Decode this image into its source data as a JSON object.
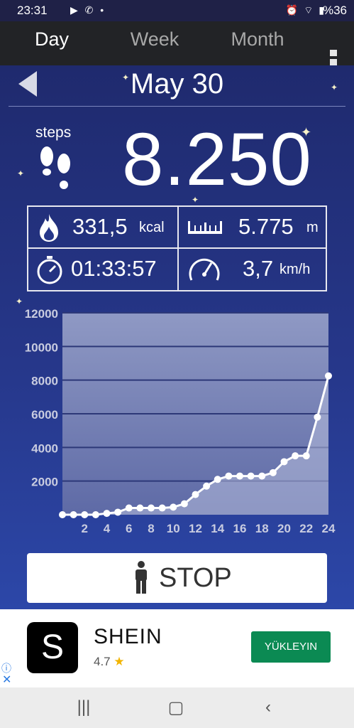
{
  "status_bar": {
    "time": "23:31",
    "app_icons": "▶ ✆ •",
    "system_icons": "⏰ ⌔ ▮",
    "battery": "%36"
  },
  "tabs": [
    {
      "label": "Day",
      "active": true
    },
    {
      "label": "Week",
      "active": false
    },
    {
      "label": "Month",
      "active": false
    }
  ],
  "header": {
    "date": "May 30"
  },
  "steps": {
    "label": "steps",
    "value": "8.250"
  },
  "stats": {
    "calories": {
      "value": "331,5",
      "unit": "kcal"
    },
    "distance": {
      "value": "5.775",
      "unit": "m"
    },
    "duration": {
      "value": "01:33:57"
    },
    "speed": {
      "value": "3,7",
      "unit": "km/h"
    }
  },
  "chart_data": {
    "type": "line",
    "x": [
      0,
      1,
      2,
      3,
      4,
      5,
      6,
      7,
      8,
      9,
      10,
      11,
      12,
      13,
      14,
      15,
      16,
      17,
      18,
      19,
      20,
      21,
      22,
      23,
      24
    ],
    "values": [
      0,
      0,
      0,
      0,
      80,
      150,
      400,
      400,
      400,
      400,
      450,
      650,
      1200,
      1700,
      2100,
      2300,
      2300,
      2300,
      2300,
      2500,
      3150,
      3500,
      3500,
      5800,
      8250
    ],
    "xticks": [
      "2",
      "4",
      "6",
      "8",
      "10",
      "12",
      "14",
      "16",
      "18",
      "20",
      "22",
      "24"
    ],
    "yticks": [
      "2000",
      "4000",
      "6000",
      "8000",
      "10000",
      "12000"
    ],
    "xlim": [
      0,
      24
    ],
    "ylim": [
      0,
      12000
    ],
    "grid": true
  },
  "stop_button": {
    "label": "STOP"
  },
  "ad": {
    "logo": "S",
    "title": "SHEIN",
    "rating": "4.7",
    "install_label": "YÜKLEYIN"
  },
  "colors": {
    "accent": "#f5f08a",
    "background_top": "#1f2a6e",
    "background_bottom": "#2c47a8",
    "install_button": "#0b8a53"
  }
}
